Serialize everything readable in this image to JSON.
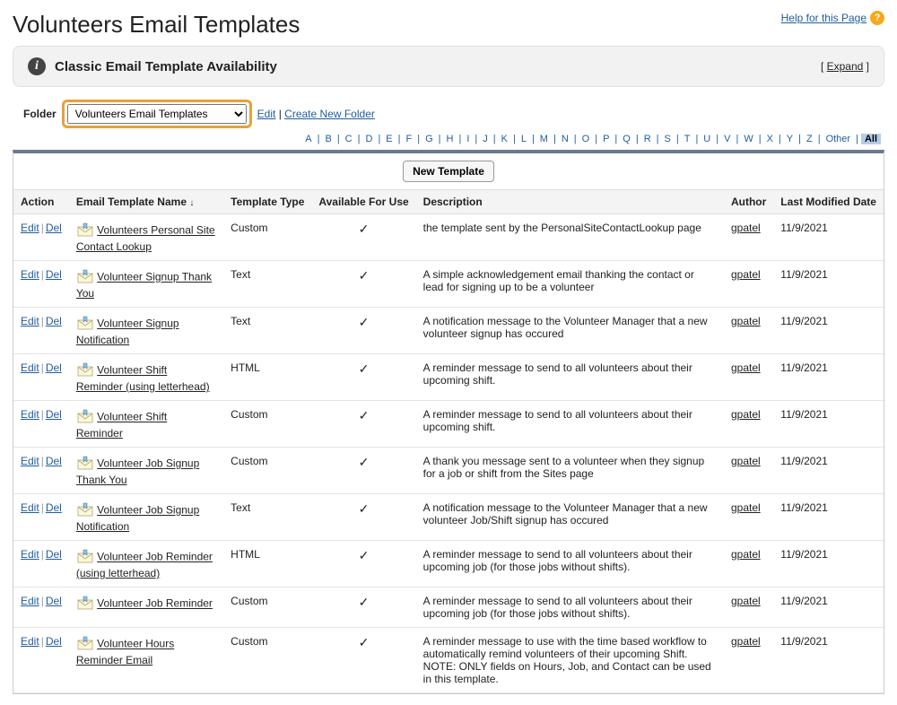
{
  "page": {
    "title": "Volunteers Email Templates",
    "help_text": "Help for this Page"
  },
  "availability": {
    "title": "Classic Email Template Availability",
    "expand_label": "Expand"
  },
  "folder": {
    "label": "Folder",
    "selected": "Volunteers Email Templates",
    "edit_label": "Edit",
    "create_label": "Create New Folder"
  },
  "alpha": {
    "letters": [
      "A",
      "B",
      "C",
      "D",
      "E",
      "F",
      "G",
      "H",
      "I",
      "J",
      "K",
      "L",
      "M",
      "N",
      "O",
      "P",
      "Q",
      "R",
      "S",
      "T",
      "U",
      "V",
      "W",
      "X",
      "Y",
      "Z"
    ],
    "other_label": "Other",
    "all_label": "All"
  },
  "toolbar": {
    "new_template_label": "New Template"
  },
  "columns": {
    "action": "Action",
    "name": "Email Template Name",
    "type": "Template Type",
    "available": "Available For Use",
    "description": "Description",
    "author": "Author",
    "modified": "Last Modified Date"
  },
  "row_actions": {
    "edit": "Edit",
    "del": "Del"
  },
  "rows": [
    {
      "name": "Volunteers Personal Site Contact Lookup",
      "type": "Custom",
      "available": true,
      "description": "the template sent by the PersonalSiteContactLookup page",
      "author": "gpatel",
      "modified": "11/9/2021"
    },
    {
      "name": "Volunteer Signup Thank You",
      "type": "Text",
      "available": true,
      "description": "A simple acknowledgement email thanking the contact or lead for signing up to be a volunteer",
      "author": "gpatel",
      "modified": "11/9/2021"
    },
    {
      "name": "Volunteer Signup Notification",
      "type": "Text",
      "available": true,
      "description": "A notification message to the Volunteer Manager that a new volunteer signup has occured",
      "author": "gpatel",
      "modified": "11/9/2021"
    },
    {
      "name": "Volunteer Shift Reminder (using letterhead)",
      "type": "HTML",
      "available": true,
      "description": "A reminder message to send to all volunteers about their upcoming shift.",
      "author": "gpatel",
      "modified": "11/9/2021"
    },
    {
      "name": "Volunteer Shift Reminder",
      "type": "Custom",
      "available": true,
      "description": "A reminder message to send to all volunteers about their upcoming shift.",
      "author": "gpatel",
      "modified": "11/9/2021"
    },
    {
      "name": "Volunteer Job Signup Thank You",
      "type": "Custom",
      "available": true,
      "description": "A thank you message sent to a volunteer when they signup for a job or shift from the Sites page",
      "author": "gpatel",
      "modified": "11/9/2021"
    },
    {
      "name": "Volunteer Job Signup Notification",
      "type": "Text",
      "available": true,
      "description": "A notification message to the Volunteer Manager that a new volunteer Job/Shift signup has occured",
      "author": "gpatel",
      "modified": "11/9/2021"
    },
    {
      "name": "Volunteer Job Reminder (using letterhead)",
      "type": "HTML",
      "available": true,
      "description": "A reminder message to send to all volunteers about their upcoming job (for those jobs without shifts).",
      "author": "gpatel",
      "modified": "11/9/2021"
    },
    {
      "name": "Volunteer Job Reminder",
      "type": "Custom",
      "available": true,
      "description": "A reminder message to send to all volunteers about their upcoming job (for those jobs without shifts).",
      "author": "gpatel",
      "modified": "11/9/2021"
    },
    {
      "name": "Volunteer Hours Reminder Email",
      "type": "Custom",
      "available": true,
      "description": "A reminder message to use with the time based workflow to automatically remind volunteers of their upcoming Shift. NOTE: ONLY fields on Hours, Job, and Contact can be used in this template.",
      "author": "gpatel",
      "modified": "11/9/2021"
    }
  ]
}
